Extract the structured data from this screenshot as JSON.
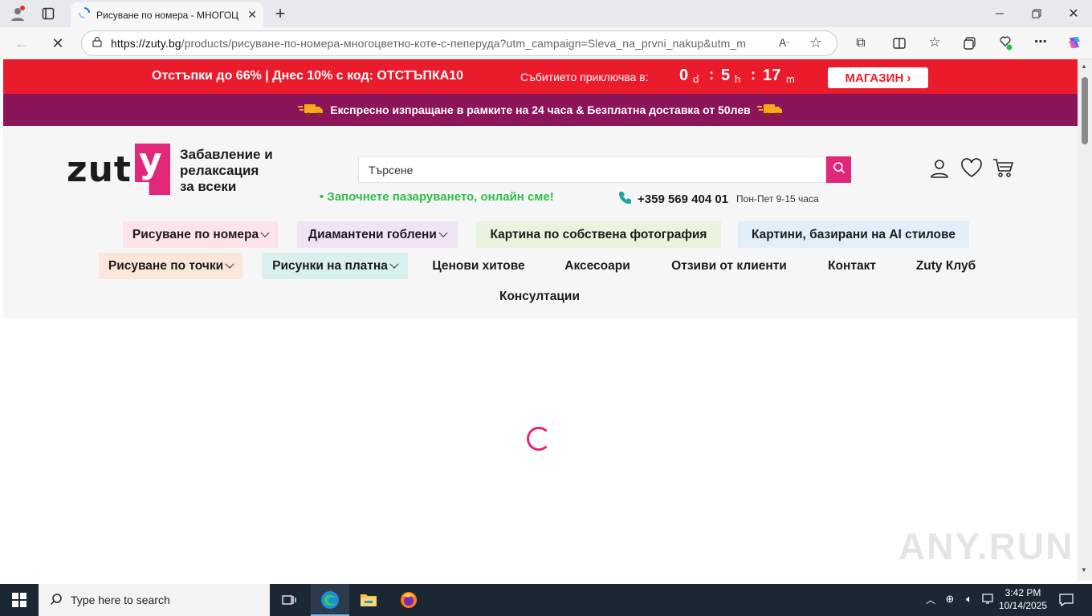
{
  "browser": {
    "tab_title": "Рисуване по номера - МНОГОЦ",
    "url_host": "https://zuty.bg",
    "url_path": "/products/рисуване-по-номера-многоцветно-коте-с-пеперуда?utm_campaign=Sleva_na_prvni_nakup&utm_m..."
  },
  "promo": {
    "text": "Отстъпки до 66% | Днес 10% с код: ОТСТЪПКА10",
    "ends_label": "Събитието приключва в:",
    "days": "0",
    "days_unit": "d",
    "hours": "5",
    "hours_unit": "h",
    "minutes": "17",
    "minutes_unit": "m",
    "sep": ":",
    "shop_button": "МАГАЗИН ›"
  },
  "shipping": {
    "text": "Експресно изпращане в рамките на 24 часа & Безплатна доставка от 50лев"
  },
  "header": {
    "logo_text": "zut",
    "logo_y": "y",
    "tagline_1": "Забавление и",
    "tagline_2": "релаксация",
    "tagline_3": "за всеки",
    "search_placeholder": "Търсене",
    "online_text": "• Започнете пазаруването, онлайн сме!",
    "phone": "+359 569 404 01",
    "hours": "Пон-Пет 9-15 часа"
  },
  "nav": {
    "row1": [
      {
        "label": "Рисуване по номера",
        "caret": true
      },
      {
        "label": "Диамантени гоблени",
        "caret": true
      },
      {
        "label": "Картина по собствена фотография",
        "caret": false
      },
      {
        "label": "Картини, базирани на AI стилове",
        "caret": false
      }
    ],
    "row2": [
      {
        "label": "Рисуване по точки",
        "caret": true
      },
      {
        "label": "Рисунки на платна",
        "caret": true
      },
      {
        "label": "Ценови хитове",
        "caret": false
      },
      {
        "label": "Аксесоари",
        "caret": false
      },
      {
        "label": "Отзиви от клиенти",
        "caret": false
      },
      {
        "label": "Контакт",
        "caret": false
      },
      {
        "label": "Zuty Клуб",
        "caret": false
      }
    ],
    "row3": [
      {
        "label": "Консултации",
        "caret": false
      }
    ]
  },
  "watermark": "ANY.RUN",
  "taskbar": {
    "search_placeholder": "Type here to search",
    "time": "3:42 PM",
    "date": "10/14/2025"
  },
  "colors": {
    "promo_red": "#ea1c2b",
    "ship_purple": "#8c1458",
    "brand_pink": "#e2267a",
    "online_green": "#2fbe4c"
  }
}
